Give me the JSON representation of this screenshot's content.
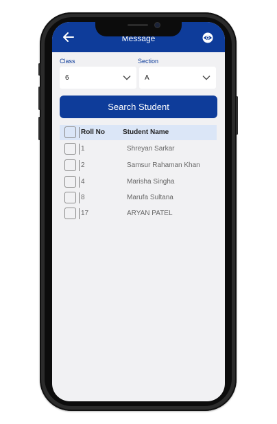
{
  "appbar": {
    "title": "Message",
    "back_icon": "arrow-left-icon",
    "right_icon": "eye-icon",
    "color": "#0e3c9a"
  },
  "filters": {
    "class_label": "Class",
    "class_value": "6",
    "section_label": "Section",
    "section_value": "A"
  },
  "search_button": {
    "label": "Search Student"
  },
  "table": {
    "headers": {
      "roll": "Roll No",
      "name": "Student Name"
    },
    "rows": [
      {
        "roll": "1",
        "name": "Shreyan Sarkar"
      },
      {
        "roll": "2",
        "name": "Samsur Rahaman Khan"
      },
      {
        "roll": "4",
        "name": "Marisha Singha"
      },
      {
        "roll": "8",
        "name": "Marufa  Sultana"
      },
      {
        "roll": "17",
        "name": "ARYAN  PATEL"
      }
    ]
  }
}
